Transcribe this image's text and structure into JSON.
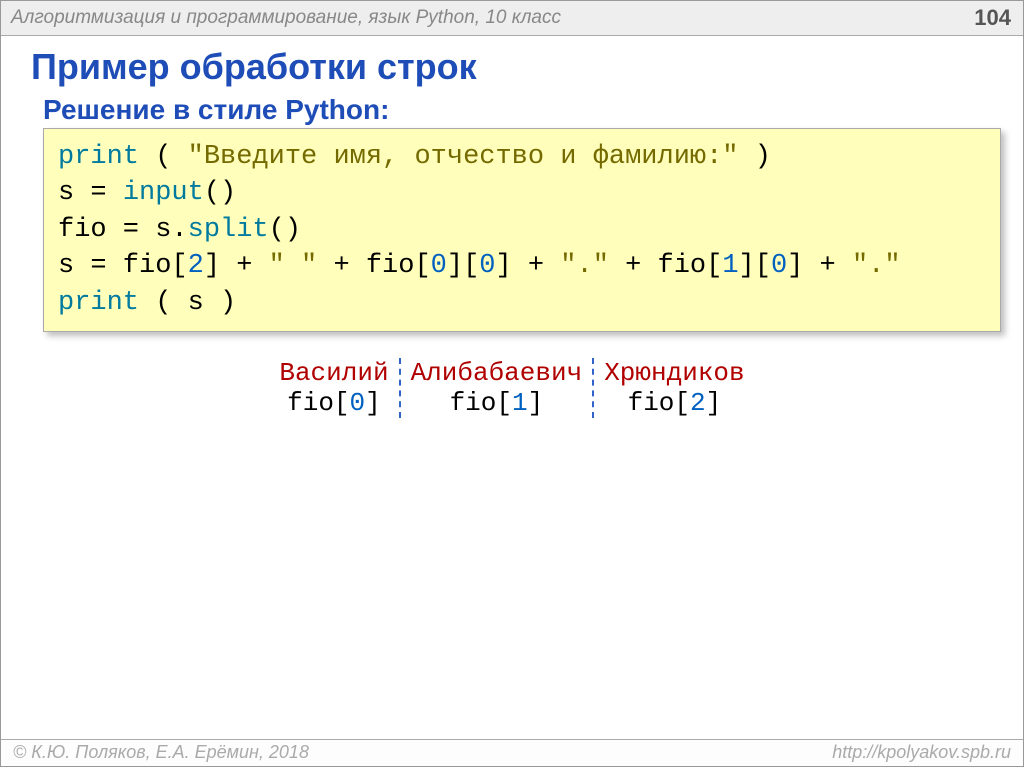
{
  "header": {
    "course": "Алгоритмизация и программирование, язык Python, 10 класс",
    "page": "104"
  },
  "title": "Пример обработки строк",
  "subtitle": "Решение в стиле Python:",
  "code": {
    "l1a": "print",
    "l1b": " ( ",
    "l1c": "\"Введите имя, отчество и фамилию:\"",
    "l1d": " )",
    "l2a": "s = ",
    "l2b": "input",
    "l2c": "()",
    "l3a": "fio = s.",
    "l3b": "split",
    "l3c": "()",
    "l4a": "s = fio[",
    "l4n2": "2",
    "l4b": "] + ",
    "l4s1": "\" \"",
    "l4c": " + fio[",
    "l4n0a": "0",
    "l4d": "][",
    "l4n0b": "0",
    "l4e": "] + ",
    "l4s2": "\".\"",
    "l4f": " + fio[",
    "l4n1": "1",
    "l4g": "][",
    "l4n0c": "0",
    "l4h": "] + ",
    "l4s3": "\".\"",
    "l5a": "print",
    "l5b": " ( s )"
  },
  "example": {
    "c0": {
      "word": "Василий",
      "ref_a": "fio[",
      "ref_n": "0",
      "ref_b": "]"
    },
    "c1": {
      "word": "Алибабаевич",
      "ref_a": "fio[",
      "ref_n": "1",
      "ref_b": "]"
    },
    "c2": {
      "word": "Хрюндиков",
      "ref_a": "fio[",
      "ref_n": "2",
      "ref_b": "]"
    }
  },
  "footer": {
    "left": "© К.Ю. Поляков, Е.А. Ерёмин, 2018",
    "right": "http://kpolyakov.spb.ru"
  }
}
